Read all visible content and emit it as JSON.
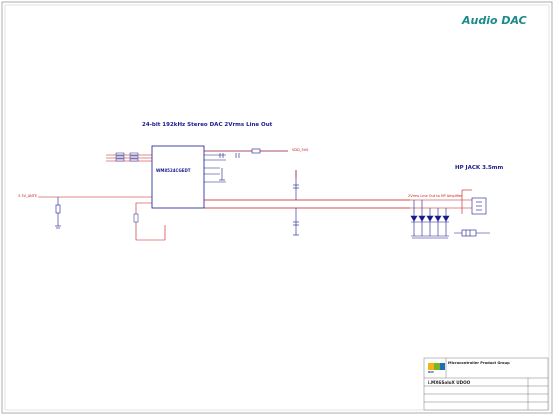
{
  "title": "Audio DAC",
  "dac_block": {
    "heading": "24-bit 192kHz Stereo DAC 2Vrms Line Out",
    "part": "WM8524CGEDT"
  },
  "hp_block": {
    "heading": "HP JACK 3.5mm"
  },
  "nets": {
    "input_power": "3.3V_ANTE",
    "output_power": "VDD_5V0",
    "hp_net": "2Vrms Line Out to HP Amplifier"
  },
  "title_block": {
    "company": "Microcontroller Product Group",
    "board": "i.MX6SoloX UDOO",
    "logo": "NXP"
  },
  "colors": {
    "title": "#1b8a8a",
    "wire": "#1a1a8c",
    "pin": "#c21818",
    "border": "#9a9a9a"
  }
}
